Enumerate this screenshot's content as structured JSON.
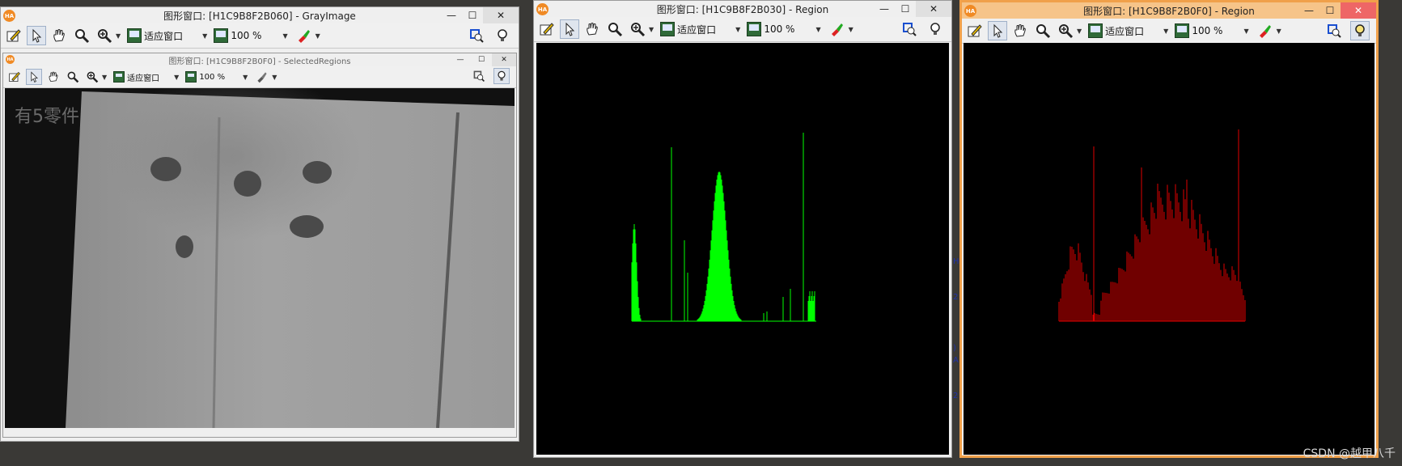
{
  "desktop": {
    "watermark": "CSDN @越甲八千",
    "side_fragments": [
      "H:",
      "2!",
      ")",
      "A!",
      "2!"
    ]
  },
  "toolbar_common": {
    "fit_label": "适应窗口",
    "zoom_label": "100 %"
  },
  "windows": {
    "gray": {
      "title": "图形窗口: [H1C9B8F2B060] - GrayImage",
      "sub_title": "图形窗口: [H1C9B8F2B0F0] - SelectedRegions",
      "sub_zoom_label": "100 %",
      "overlay_text": "有5零件"
    },
    "green": {
      "title": "图形窗口: [H1C9B8F2B030] - Region"
    },
    "red": {
      "title": "图形窗口: [H1C9B8F2B0F0] - Region"
    }
  },
  "window_controls": {
    "minimize": "—",
    "maximize": "☐",
    "close": "✕"
  },
  "colors": {
    "active_border": "#f0a04a",
    "green_hist": "#00ff00",
    "red_hist": "#e00000"
  },
  "icons": [
    "pencil-icon",
    "pointer-icon",
    "hand-icon",
    "magnifier-icon",
    "zoom-in-icon",
    "paint-icon",
    "inspect-icon",
    "lightbulb-icon"
  ]
}
